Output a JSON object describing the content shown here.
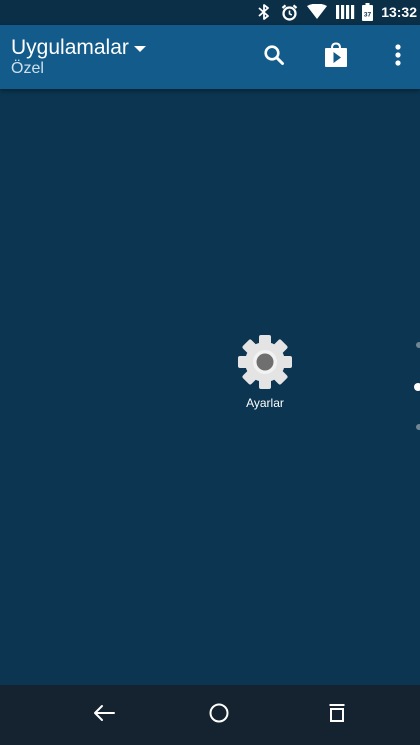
{
  "status_bar": {
    "time": "13:32",
    "battery_level": "37",
    "icons": [
      "bluetooth-icon",
      "alarm-icon",
      "wifi-icon",
      "signal-icon",
      "battery-icon"
    ]
  },
  "toolbar": {
    "title": "Uygulamalar",
    "subtitle": "Özel",
    "actions": [
      "search-icon",
      "play-store-icon",
      "more-vert-icon"
    ]
  },
  "apps": [
    {
      "label": "Ayarlar",
      "icon": "settings-gear-icon"
    }
  ],
  "pager": {
    "page_count": 3,
    "current_page": 2
  },
  "navigation_bar": {
    "buttons": [
      "back-arrow-icon",
      "home-circle-icon",
      "recents-icon"
    ]
  },
  "colors": {
    "background": "#0b3551",
    "toolbar": "#125b8a",
    "status_bar": "#0a2f47",
    "nav_bar": "#14232f",
    "icon_white": "#ffffff"
  }
}
